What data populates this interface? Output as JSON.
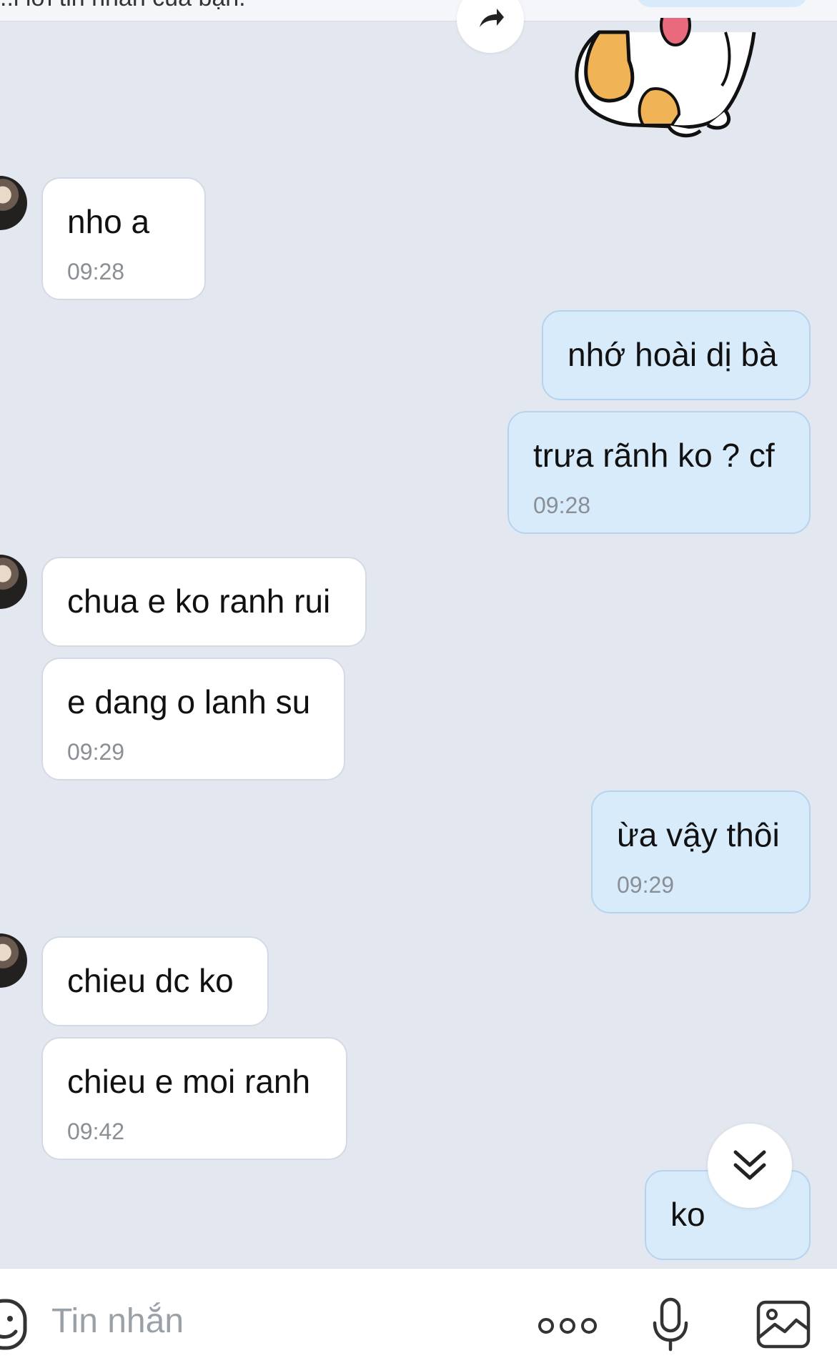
{
  "header": {
    "partial_text": "..i lời tin nhắn của bạn."
  },
  "messages": [
    {
      "sender": "other",
      "text": "nho a",
      "time": "09:28"
    },
    {
      "sender": "me",
      "text": "nhớ hoài dị bà",
      "time": ""
    },
    {
      "sender": "me",
      "text": "trưa rãnh ko ? cf",
      "time": "09:28"
    },
    {
      "sender": "other",
      "text": "chua e ko ranh rui",
      "time": ""
    },
    {
      "sender": "other",
      "text": "e dang o lanh su",
      "time": "09:29"
    },
    {
      "sender": "me",
      "text": "ừa vậy thôi",
      "time": "09:29"
    },
    {
      "sender": "other",
      "text": "chieu dc ko",
      "time": ""
    },
    {
      "sender": "other",
      "text": "chieu e moi ranh",
      "time": "09:42"
    },
    {
      "sender": "me",
      "text": "ko",
      "time": ""
    }
  ],
  "composer": {
    "placeholder": "Tin nhắn",
    "value": ""
  },
  "icons": {
    "forward": "forward-arrow-icon",
    "sticker": "shiba-dog-sticker",
    "scroll": "double-chevron-down-icon",
    "emoji": "emoji-icon",
    "more": "more-dots-icon",
    "mic": "microphone-icon",
    "image": "image-icon"
  },
  "colors": {
    "background": "#e3e8f0",
    "bubble_mine": "#d8ebfb",
    "bubble_other": "#ffffff",
    "time_text": "#8a8f96"
  }
}
